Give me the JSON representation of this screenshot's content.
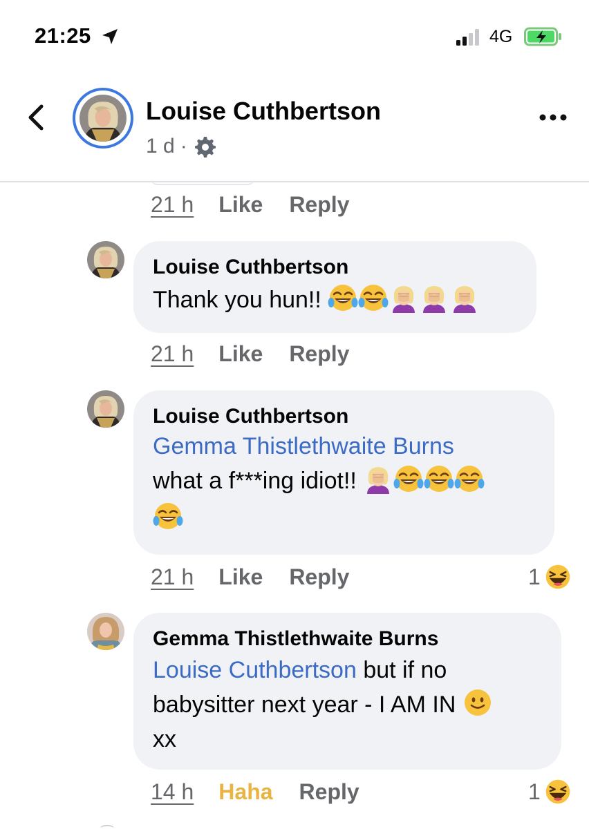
{
  "status_bar": {
    "time": "21:25",
    "network": "4G"
  },
  "header": {
    "author": "Louise Cuthbertson",
    "time": "1 d",
    "separator": "·"
  },
  "comments": [
    {
      "author": "Louise Cuthbertson",
      "text": "Thank you hun!!",
      "emojis": [
        "laughing-crying",
        "laughing-crying",
        "facepalm",
        "facepalm",
        "facepalm"
      ],
      "time": "21 h",
      "like": "Like",
      "reply": "Reply"
    },
    {
      "author": "Louise Cuthbertson",
      "mention": "Gemma Thistlethwaite Burns",
      "text": "what a f***ing idiot!!",
      "emojis": [
        "facepalm",
        "laughing-crying",
        "laughing-crying",
        "laughing-crying",
        "laughing-crying"
      ],
      "time": "21 h",
      "like": "Like",
      "reply": "Reply",
      "reaction_count": "1"
    },
    {
      "author": "Gemma Thistlethwaite Burns",
      "mention": "Louise Cuthbertson",
      "text_line1": "but if no",
      "text_line2": "babysitter next year - I AM IN",
      "text_line3": "xx",
      "emojis": [
        "slight-smile"
      ],
      "time": "14 h",
      "like": "Haha",
      "reply": "Reply",
      "reaction_count": "1"
    }
  ],
  "top_actions": {
    "time": "21 h",
    "like": "Like",
    "reply": "Reply"
  },
  "colors": {
    "mention": "#3b6bc4",
    "haha_active": "#e9b442",
    "bubble": "#f0f2f5",
    "story_ring": "#3c78e0"
  },
  "icons": [
    "location-arrow-icon",
    "signal-icon",
    "battery-charging-icon",
    "back-chevron-icon",
    "gear-icon",
    "more-dots-icon",
    "haha-reaction-icon"
  ]
}
